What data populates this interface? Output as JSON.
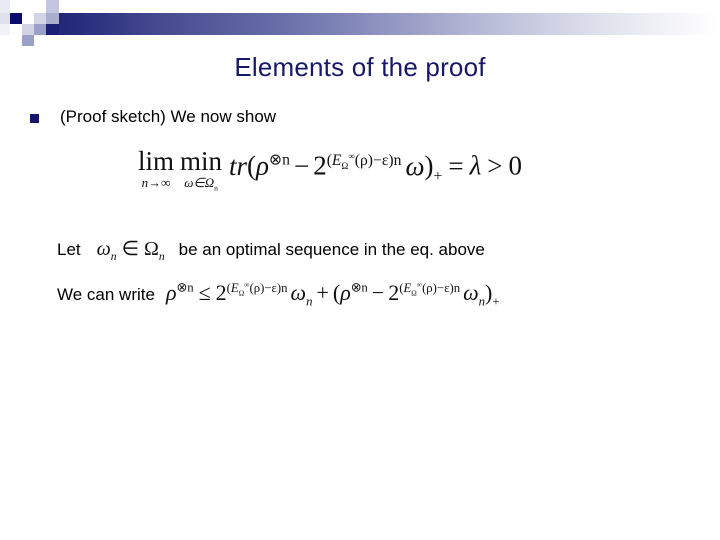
{
  "slide": {
    "title": "Elements of the proof",
    "decoration": {
      "name": "top-gradient-band",
      "gradient_start": "#1d2272",
      "gradient_end": "#ffffff",
      "accent_dark": "#0b0b6e",
      "accent_mid": "#9ba0c6",
      "accent_light": "#d3d5e7"
    },
    "title_color": "#17176b",
    "bullet_color": "#15156b"
  },
  "body": {
    "bullet": {
      "marker": "square-bullet",
      "text": "(Proof sketch) We now show"
    },
    "equation_main": {
      "limit_op": "lim",
      "limit_under": "n→∞",
      "min_op": "min",
      "min_under": "ω∈Ω",
      "min_under_sub": "n",
      "trace": "tr",
      "open_paren": "(",
      "rho": "ρ",
      "rho_exp": "⊗n",
      "minus": "−",
      "base": "2",
      "exponent_open": "(",
      "exponent_E": "E",
      "exponent_E_sub": "Ω",
      "exponent_E_sup": "∞",
      "exponent_arg": "(ρ)",
      "exponent_minus_eps": "−ε",
      "exponent_close": ")n",
      "omega": "ω",
      "close_paren": ")",
      "plus_sub": "+",
      "equals": "=",
      "lambda": "λ",
      "gt": ">",
      "zero": "0"
    },
    "let_line": {
      "prefix": "Let",
      "omega": "ω",
      "omega_sub": "n",
      "in": "∈",
      "big_omega": "Ω",
      "big_omega_sub": "n",
      "suffix": "be an optimal sequence in the eq. above"
    },
    "write_line": {
      "prefix": "We can write",
      "rho": "ρ",
      "rho_exp": "⊗n",
      "leq": "≤",
      "base": "2",
      "exponent": "(EΩ∞(ρ)−ε)n",
      "omega": "ω",
      "omega_sub": "n",
      "plus": "+",
      "open_paren": "(",
      "minus": "−",
      "close_paren": ")",
      "plus_sub": "+"
    }
  }
}
